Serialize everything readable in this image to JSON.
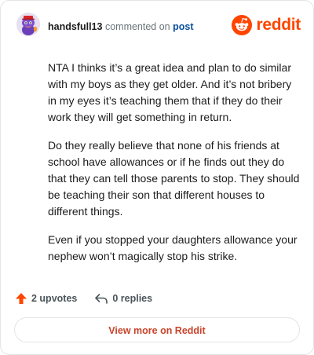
{
  "header": {
    "username": "handsfull13",
    "action_text": "commented on",
    "post_link": "post",
    "brand": "reddit"
  },
  "comment": {
    "paragraphs": [
      "NTA I thinks it’s a great idea and plan to do similar with my boys as they get older. And it’s not bribery in my eyes it’s teaching them that if they do their work they will get something in return.",
      "Do they really believe that none of his friends at school have allowances or if he finds out they do that they can tell those parents to stop. They should be teaching their son that different houses to different things.",
      "Even if you stopped your daughters allowance your nephew won’t magically stop his strike."
    ]
  },
  "actions": {
    "upvotes": "2 upvotes",
    "replies": "0 replies"
  },
  "footer": {
    "view_more": "View more on Reddit"
  },
  "colors": {
    "brand_orange": "#ff4500",
    "link_blue": "#0a4f9e",
    "view_more_text": "#c9442b"
  },
  "icons": {
    "avatar": "snoo-avatar-icon",
    "logo": "reddit-snoo-icon",
    "upvote": "upvote-arrow-icon",
    "reply": "reply-arrow-icon"
  }
}
